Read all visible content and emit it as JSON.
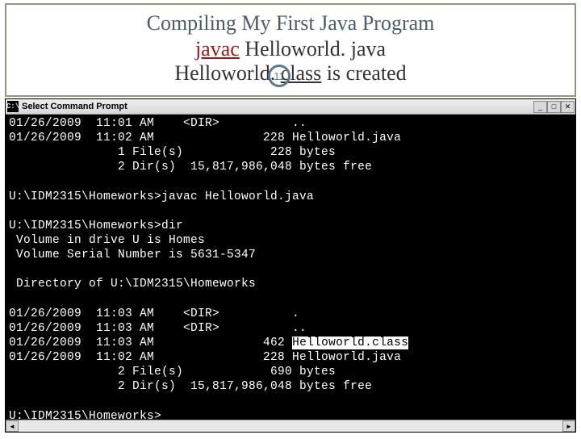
{
  "header": {
    "title": "Compiling My First Java Program",
    "javac": "javac",
    "cmd_rest": " Helloworld. java",
    "result_pre": "Helloworld. ",
    "result_class": "class",
    "result_post": " is created",
    "page_num": "11"
  },
  "titlebar": {
    "icon_text": "C:\\",
    "title": "Select Command Prompt",
    "min": "_",
    "max": "□",
    "close": "✕"
  },
  "scrollbar": {
    "left": "◄",
    "right": "►"
  },
  "term": {
    "l1": "01/26/2009  11:01 AM    <DIR>          ..",
    "l2": "01/26/2009  11:02 AM               228 Helloworld.java",
    "l3": "               1 File(s)            228 bytes",
    "l4": "               2 Dir(s)  15,817,986,048 bytes free",
    "l5": "",
    "l6": "U:\\IDM2315\\Homeworks>javac Helloworld.java",
    "l7": "",
    "l8": "U:\\IDM2315\\Homeworks>dir",
    "l9": " Volume in drive U is Homes",
    "l10": " Volume Serial Number is 5631-5347",
    "l11": "",
    "l12": " Directory of U:\\IDM2315\\Homeworks",
    "l13": "",
    "l14": "01/26/2009  11:03 AM    <DIR>          .",
    "l15": "01/26/2009  11:03 AM    <DIR>          ..",
    "l16a": "01/26/2009  11:03 AM               462 ",
    "l16b": "Helloworld.class",
    "l17": "01/26/2009  11:02 AM               228 Helloworld.java",
    "l18": "               2 File(s)            690 bytes",
    "l19": "               2 Dir(s)  15,817,986,048 bytes free",
    "l20": "",
    "l21": "U:\\IDM2315\\Homeworks>"
  }
}
